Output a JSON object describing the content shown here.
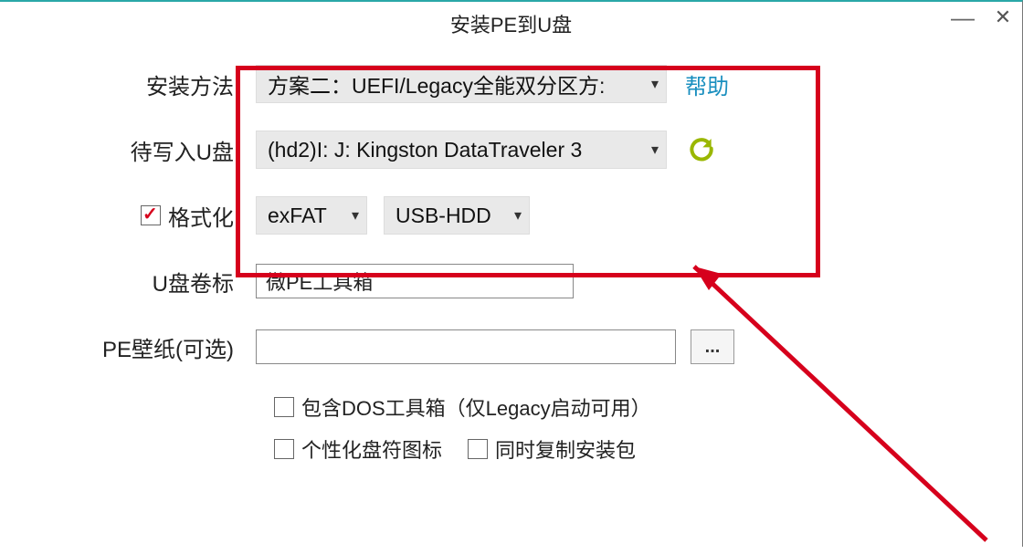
{
  "window": {
    "title": "安装PE到U盘"
  },
  "labels": {
    "method": "安装方法",
    "usb": "待写入U盘",
    "format": "格式化",
    "volume": "U盘卷标",
    "wallpaper": "PE壁纸(可选)"
  },
  "fields": {
    "method_value": "方案二：UEFI/Legacy全能双分区方:",
    "usb_value": "(hd2)I: J: Kingston DataTraveler 3",
    "fs_value": "exFAT",
    "mode_value": "USB-HDD",
    "volume_value": "微PE工具箱",
    "wallpaper_value": ""
  },
  "actions": {
    "help": "帮助",
    "browse": "..."
  },
  "options": {
    "dos": "包含DOS工具箱（仅Legacy启动可用）",
    "custom_icon": "个性化盘符图标",
    "copy_installer": "同时复制安装包"
  }
}
